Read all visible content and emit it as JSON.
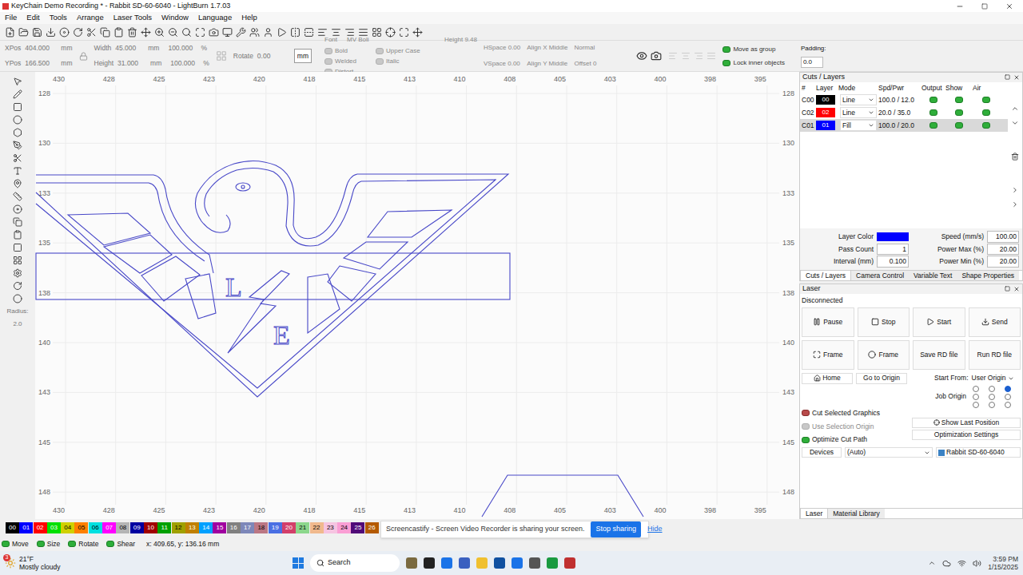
{
  "window": {
    "title": "KeyChain Demo Recording * - Rabbit SD-60-6040 - LightBurn 1.7.03"
  },
  "menu": [
    "File",
    "Edit",
    "Tools",
    "Arrange",
    "Laser Tools",
    "Window",
    "Language",
    "Help"
  ],
  "numeric_toolbar": {
    "position": [
      {
        "label": "XPos",
        "value": "404.000",
        "unit": "mm"
      },
      {
        "label": "YPos",
        "value": "166.500",
        "unit": "mm"
      }
    ],
    "size": [
      {
        "label": "Width",
        "value": "45.000",
        "unit": "mm",
        "scale": "100.000",
        "pct": "%"
      },
      {
        "label": "Height",
        "value": "31.000",
        "unit": "mm",
        "scale": "100.000",
        "pct": "%"
      }
    ],
    "rotate": {
      "label": "Rotate",
      "value": "0.00"
    },
    "units": "mm"
  },
  "text_toolbar": {
    "font_label": "Font",
    "font": "MV Boli",
    "height_label": "Height",
    "height": "9.48",
    "hspace_label": "HSpace",
    "hspace": "0.00",
    "vspace_label": "VSpace",
    "vspace": "0.00",
    "align_x_label": "Align X",
    "align_x": "Middle",
    "align_y_label": "Align Y",
    "align_y": "Middle",
    "style": "Normal",
    "offset_label": "Offset",
    "offset": "0",
    "options": [
      {
        "label": "Bold",
        "checked": false
      },
      {
        "label": "Upper Case",
        "checked": false
      },
      {
        "label": "Welded",
        "checked": false
      },
      {
        "label": "Italic",
        "checked": false
      },
      {
        "label": "Distort",
        "checked": false
      }
    ]
  },
  "group_options": [
    {
      "label": "Move as group",
      "checked": true
    },
    {
      "label": "Lock inner objects",
      "checked": true
    }
  ],
  "padding": {
    "label": "Padding:",
    "value": "0.0"
  },
  "tools": {
    "radius_label": "Radius:",
    "radius": "2.0"
  },
  "rulers": {
    "x": [
      "430",
      "428",
      "425",
      "423",
      "420",
      "418",
      "415",
      "413",
      "410",
      "408",
      "405",
      "403",
      "400",
      "398",
      "395"
    ],
    "y": [
      "128",
      "130",
      "133",
      "135",
      "138",
      "140",
      "143",
      "145",
      "148"
    ]
  },
  "canvas": {
    "texts": [
      "L",
      "E"
    ]
  },
  "cuts_layers": {
    "title": "Cuts / Layers",
    "columns": [
      "#",
      "Layer",
      "Mode",
      "Spd/Pwr",
      "Output",
      "Show",
      "Air"
    ],
    "rows": [
      {
        "id": "C00",
        "layer": "00",
        "color": "#000000",
        "mode": "Line",
        "spd_pwr": "100.0 / 12.0",
        "output": true,
        "show": true,
        "air": true,
        "selected": false
      },
      {
        "id": "C02",
        "layer": "02",
        "color": "#ff0000",
        "mode": "Line",
        "spd_pwr": "20.0 / 35.0",
        "output": true,
        "show": true,
        "air": true,
        "selected": false
      },
      {
        "id": "C01",
        "layer": "01",
        "color": "#0000ff",
        "mode": "Fill",
        "spd_pwr": "100.0 / 20.0",
        "output": true,
        "show": true,
        "air": true,
        "selected": true
      }
    ],
    "layer_color_label": "Layer Color",
    "layer_color": "#0000ff",
    "settings": [
      {
        "label": "Speed (mm/s)",
        "value": "100.00"
      },
      {
        "label": "Pass Count",
        "value": "1"
      },
      {
        "label": "Power Max (%)",
        "value": "20.00"
      },
      {
        "label": "Interval (mm)",
        "value": "0.100"
      },
      {
        "label": "Power Min (%)",
        "value": "20.00"
      }
    ]
  },
  "tabs": [
    {
      "label": "Cuts / Layers",
      "selected": true
    },
    {
      "label": "Camera Control",
      "selected": false
    },
    {
      "label": "Variable Text",
      "selected": false
    },
    {
      "label": "Shape Properties",
      "selected": false
    }
  ],
  "laser": {
    "title": "Laser",
    "status": "Disconnected",
    "buttons": [
      "Pause",
      "Stop",
      "Start",
      "Send",
      "Frame",
      "Frame",
      "Save RD file",
      "Run RD file"
    ],
    "home": "Home",
    "go_to_origin": "Go to Origin",
    "start_from_label": "Start From:",
    "start_from": "User Origin",
    "job_origin_label": "Job Origin",
    "job_origin": [
      false,
      false,
      true,
      false,
      false,
      false,
      false,
      false,
      false
    ],
    "options": [
      {
        "label": "Cut Selected Graphics",
        "checked": false,
        "disabled": false
      },
      {
        "label": "Use Selection Origin",
        "checked": false,
        "disabled": true
      },
      {
        "label": "Optimize Cut Path",
        "checked": true,
        "disabled": false
      }
    ],
    "show_last_position": "Show Last Position",
    "optimization_settings": "Optimization Settings",
    "devices_label": "Devices",
    "devices": "(Auto)",
    "device": "Rabbit SD-60-6040"
  },
  "laser_tabs": [
    {
      "label": "Laser",
      "selected": true
    },
    {
      "label": "Material Library",
      "selected": false
    }
  ],
  "palette": [
    {
      "label": "00",
      "color": "#000000"
    },
    {
      "label": "01",
      "color": "#0000ff"
    },
    {
      "label": "02",
      "color": "#ff0000"
    },
    {
      "label": "03",
      "color": "#00e000"
    },
    {
      "label": "04",
      "color": "#d0d000"
    },
    {
      "label": "05",
      "color": "#ff8000"
    },
    {
      "label": "06",
      "color": "#00e0e0"
    },
    {
      "label": "07",
      "color": "#ff00ff"
    },
    {
      "label": "08",
      "color": "#b4b4b4"
    },
    {
      "label": "09",
      "color": "#0000a0"
    },
    {
      "label": "10",
      "color": "#a00000"
    },
    {
      "label": "11",
      "color": "#00a000"
    },
    {
      "label": "12",
      "color": "#a0a000"
    },
    {
      "label": "13",
      "color": "#c08000"
    },
    {
      "label": "14",
      "color": "#00a0ff"
    },
    {
      "label": "15",
      "color": "#a000a0"
    },
    {
      "label": "16",
      "color": "#808080"
    },
    {
      "label": "17",
      "color": "#7d87b9"
    },
    {
      "label": "18",
      "color": "#bb7784"
    },
    {
      "label": "19",
      "color": "#4a6fe3"
    },
    {
      "label": "20",
      "color": "#d33f6a"
    },
    {
      "label": "21",
      "color": "#8cd78c"
    },
    {
      "label": "22",
      "color": "#f0b98d"
    },
    {
      "label": "23",
      "color": "#f6c4e1"
    },
    {
      "label": "24",
      "color": "#fa9ed4"
    },
    {
      "label": "25",
      "color": "#500a78"
    },
    {
      "label": "26",
      "color": "#b45a00"
    }
  ],
  "share_bar": {
    "message": "Screencastify - Screen Video Recorder is sharing your screen.",
    "stop": "Stop sharing",
    "hide": "Hide"
  },
  "status_bar": {
    "modes": [
      {
        "label": "Move",
        "on": true
      },
      {
        "label": "Size",
        "on": true
      },
      {
        "label": "Rotate",
        "on": true
      },
      {
        "label": "Shear",
        "on": true
      }
    ],
    "coords": "x: 409.65, y: 136.16 mm"
  },
  "taskbar": {
    "weather_badge": "3",
    "temp": "21°F",
    "weather": "Mostly cloudy",
    "search": "Search",
    "time": "3:59 PM",
    "date": "1/15/2025"
  }
}
